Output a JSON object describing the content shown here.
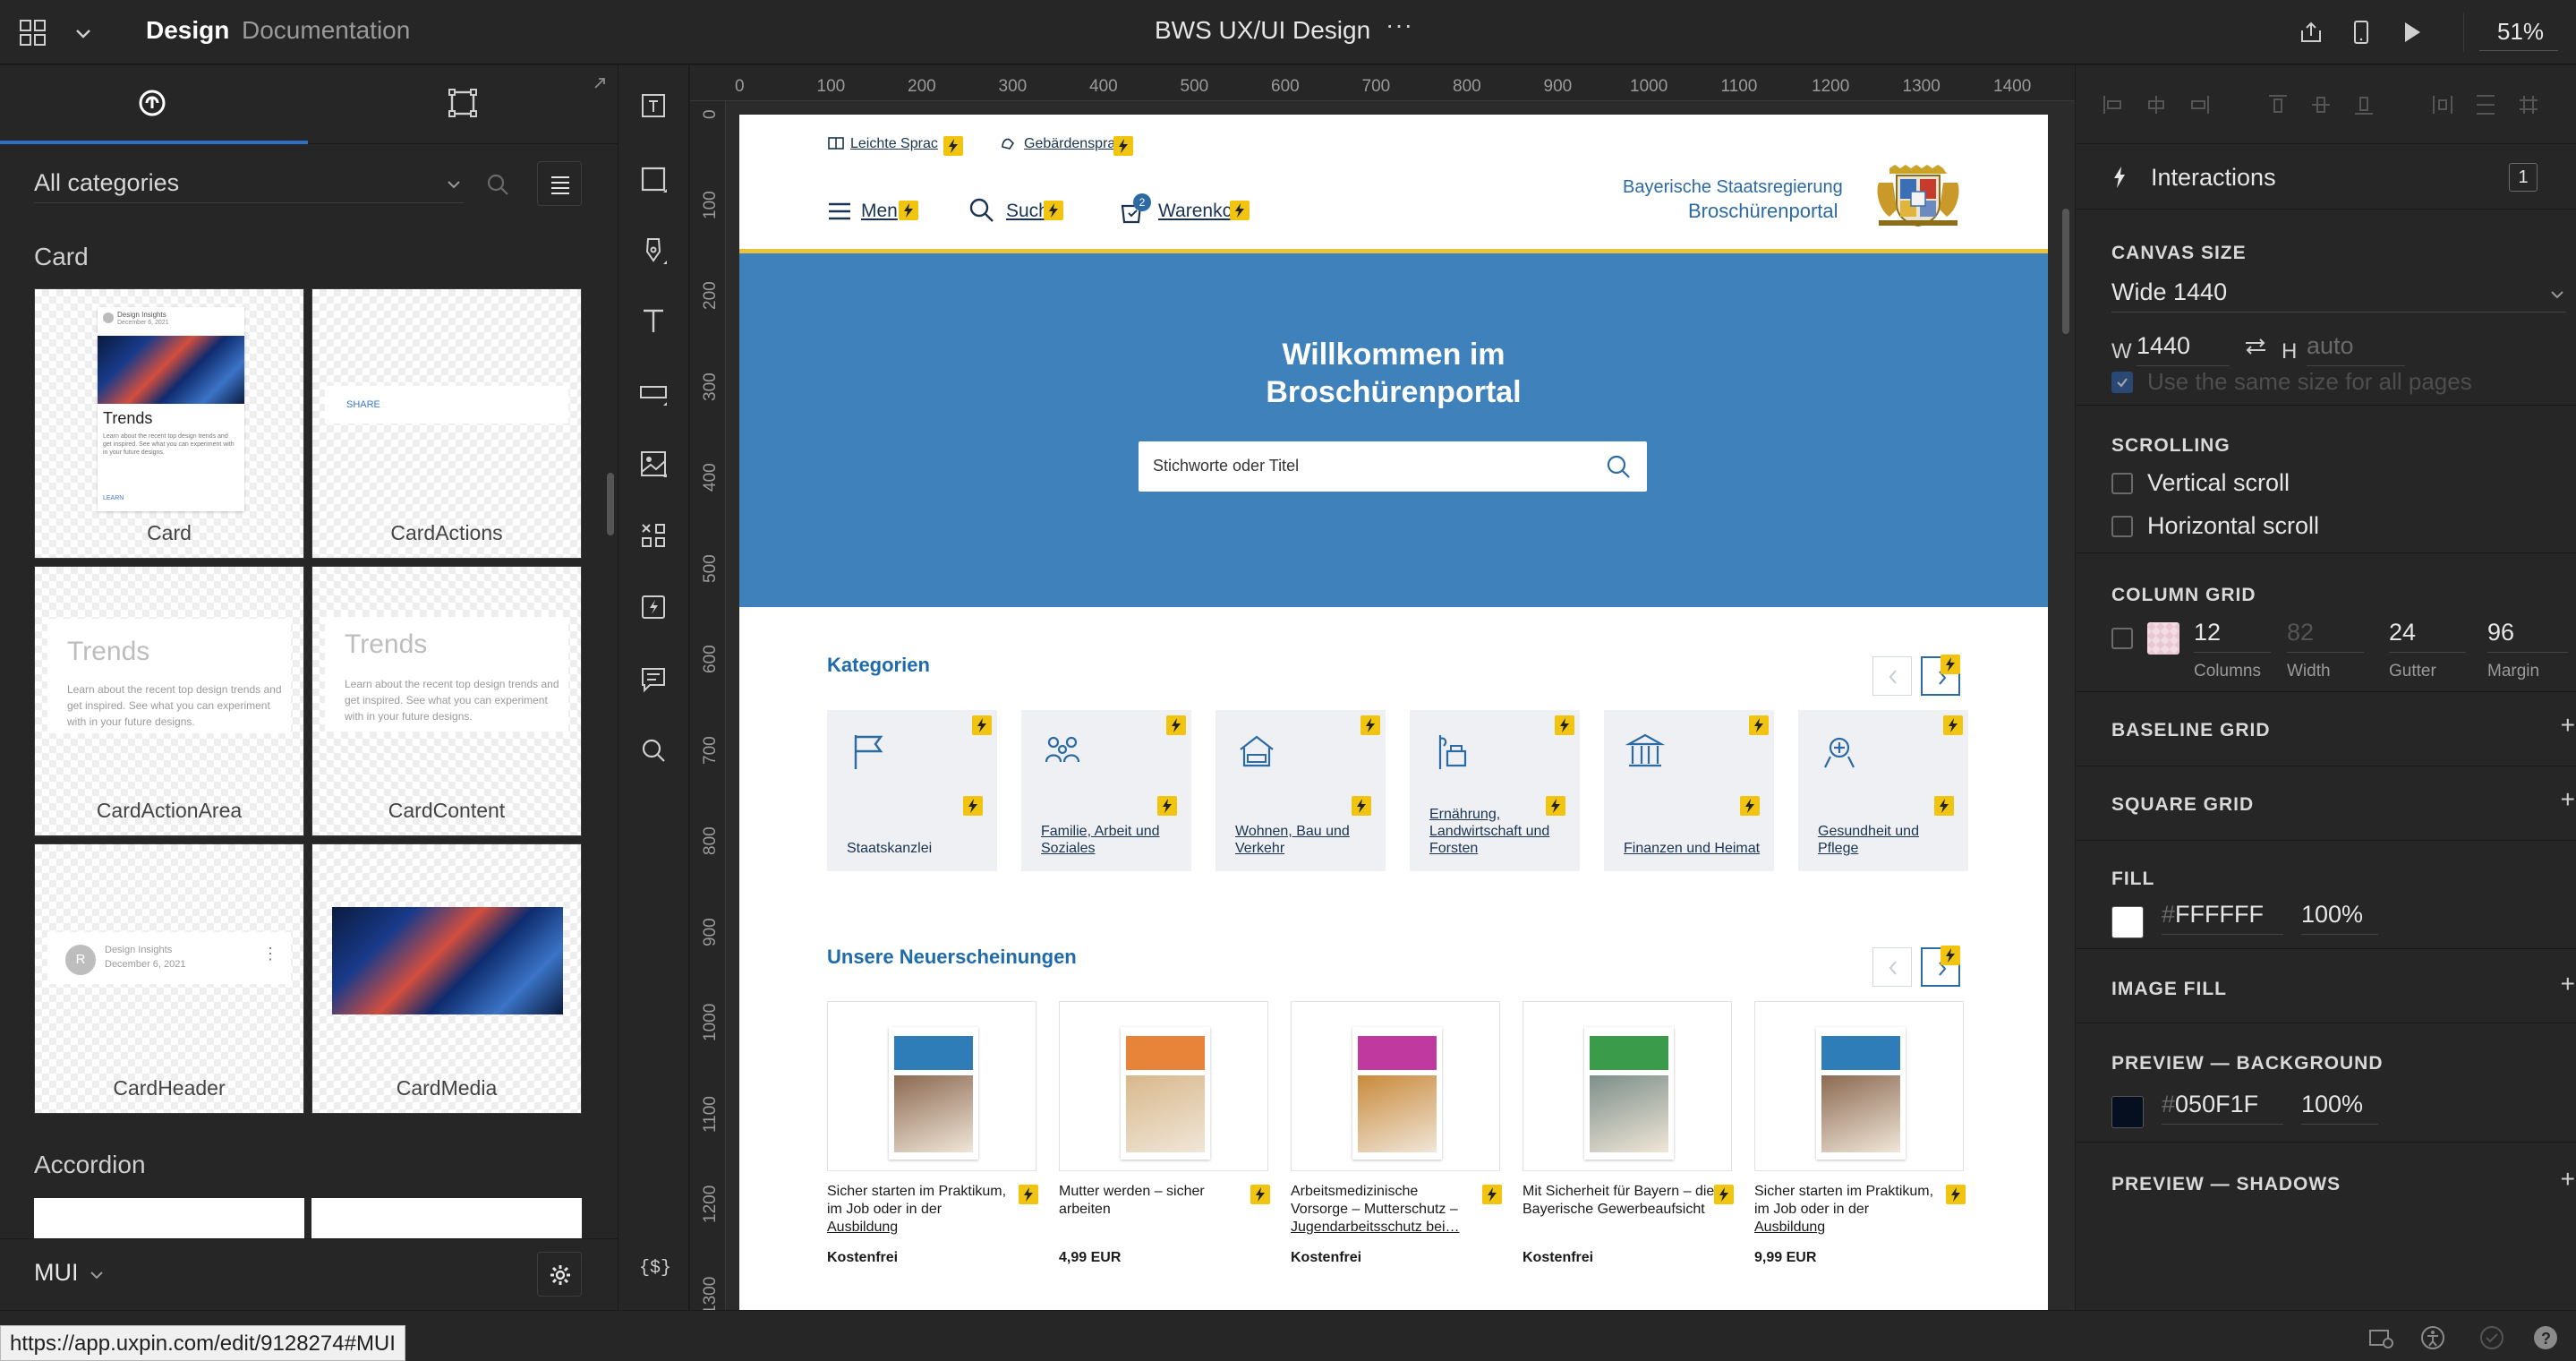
{
  "topbar": {
    "tab_design": "Design",
    "tab_documentation": "Documentation",
    "title": "BWS UX/UI Design",
    "more": "···",
    "zoom": "51%"
  },
  "left_panel": {
    "category_select": "All categories",
    "sections": [
      {
        "title": "Card",
        "items": [
          "Card",
          "CardActions",
          "CardActionArea",
          "CardContent",
          "CardHeader",
          "CardMedia"
        ]
      },
      {
        "title": "Accordion",
        "items": []
      }
    ],
    "previews": {
      "card_header_title": "Design Insights",
      "card_header_date": "December 6, 2021",
      "card_title": "Trends",
      "card_text": "Learn about the recent top design trends and get inspired. See what you can experiment with in your future designs.",
      "card_link": "LEARN",
      "card_actions_share": "SHARE",
      "area_title": "Trends",
      "area_text": "Learn about the recent top design trends and get inspired. See what you can experiment with in your future designs.",
      "content_title": "Trends",
      "content_text": "Learn about the recent top design trends and get inspired. See what you can experiment with in your future designs.",
      "header_avatar": "R",
      "header_title": "Design Insights",
      "header_date": "December 6, 2021"
    },
    "library": "MUI"
  },
  "rulers": {
    "top": [
      "0",
      "100",
      "200",
      "300",
      "400",
      "500",
      "600",
      "700",
      "800",
      "900",
      "1000",
      "1100",
      "1200",
      "1300",
      "1400"
    ],
    "left": [
      "0",
      "100",
      "200",
      "300",
      "400",
      "500",
      "600",
      "700",
      "800",
      "900",
      "1000",
      "1100",
      "1200",
      "1300"
    ]
  },
  "page": {
    "top_links": [
      "Leichte Sprac",
      "Gebärdenspra"
    ],
    "nav": [
      "Men",
      "Such",
      "Warenkc"
    ],
    "cart_count": "2",
    "logo_line1": "Bayerische Staatsregierung",
    "logo_line2": "Broschürenportal",
    "hero_title_1": "Willkommen im",
    "hero_title_2": "Broschürenportal",
    "search_placeholder": "Stichworte oder Titel",
    "categories_title": "Kategorien",
    "categories": [
      "Staatskanzlei",
      "Familie, Arbeit und Soziales",
      "Wohnen, Bau und Verkehr",
      "Ernährung, Landwirtschaft und Forsten",
      "Finanzen und Heimat",
      "Gesundheit und Pflege"
    ],
    "new_title": "Unsere Neuerscheinungen",
    "books": [
      {
        "line1": "Sicher starten im Praktikum,",
        "line2": "im Job oder in der",
        "line3": "Ausbildung",
        "price": "Kostenfrei",
        "cover": "#2f7db8",
        "photo": "#8c6a52"
      },
      {
        "line1": "Mutter werden – sicher",
        "line2": "arbeiten",
        "line3": "",
        "price": "4,99 EUR",
        "cover": "#e8843a",
        "photo": "#d8b88c"
      },
      {
        "line1": "Arbeitsmedizinische",
        "line2": "Vorsorge – Mutterschutz –",
        "line3": "Jugendarbeitsschutz bei…",
        "price": "Kostenfrei",
        "cover": "#c0399e",
        "photo": "#c98a3b"
      },
      {
        "line1": "Mit Sicherheit für Bayern – die",
        "line2": "Bayerische Gewerbeaufsicht",
        "line3": "",
        "price": "Kostenfrei",
        "cover": "#3a9c4a",
        "photo": "#7d8f8a"
      },
      {
        "line1": "Sicher starten im Praktikum,",
        "line2": "im Job oder in der",
        "line3": "Ausbildung",
        "price": "9,99 EUR",
        "cover": "#2f7db8",
        "photo": "#8c6a52"
      }
    ]
  },
  "right_panel": {
    "interactions_label": "Interactions",
    "interactions_count": "1",
    "canvas_size": {
      "title": "CANVAS SIZE",
      "preset": "Wide 1440",
      "w_label": "W",
      "w_value": "1440",
      "h_label": "H",
      "h_placeholder": "auto",
      "same_size": "Use the same size for all pages"
    },
    "scrolling": {
      "title": "SCROLLING",
      "vertical": "Vertical scroll",
      "horizontal": "Horizontal scroll"
    },
    "column_grid": {
      "title": "COLUMN GRID",
      "columns": "12",
      "width": "82",
      "gutter": "24",
      "margin": "96",
      "columns_label": "Columns",
      "width_label": "Width",
      "gutter_label": "Gutter",
      "margin_label": "Margin"
    },
    "baseline_grid": "BASELINE GRID",
    "square_grid": "SQUARE GRID",
    "fill": {
      "title": "FILL",
      "hash": "#",
      "hex": "FFFFFF",
      "opacity": "100%",
      "color": "#FFFFFF"
    },
    "image_fill": "IMAGE FILL",
    "preview_bg": {
      "title": "PREVIEW — BACKGROUND",
      "hash": "#",
      "hex": "050F1F",
      "opacity": "100%",
      "color": "#050F1F"
    },
    "preview_shadows": "PREVIEW — SHADOWS",
    "plus": "+"
  },
  "statusbar": {
    "url": "https://app.uxpin.com/edit/9128274#MUI"
  },
  "colors": {
    "accent": "#2d6fc4",
    "hero": "#3f81ba",
    "bolt": "#f1c40f",
    "link": "#1f6aa8"
  }
}
